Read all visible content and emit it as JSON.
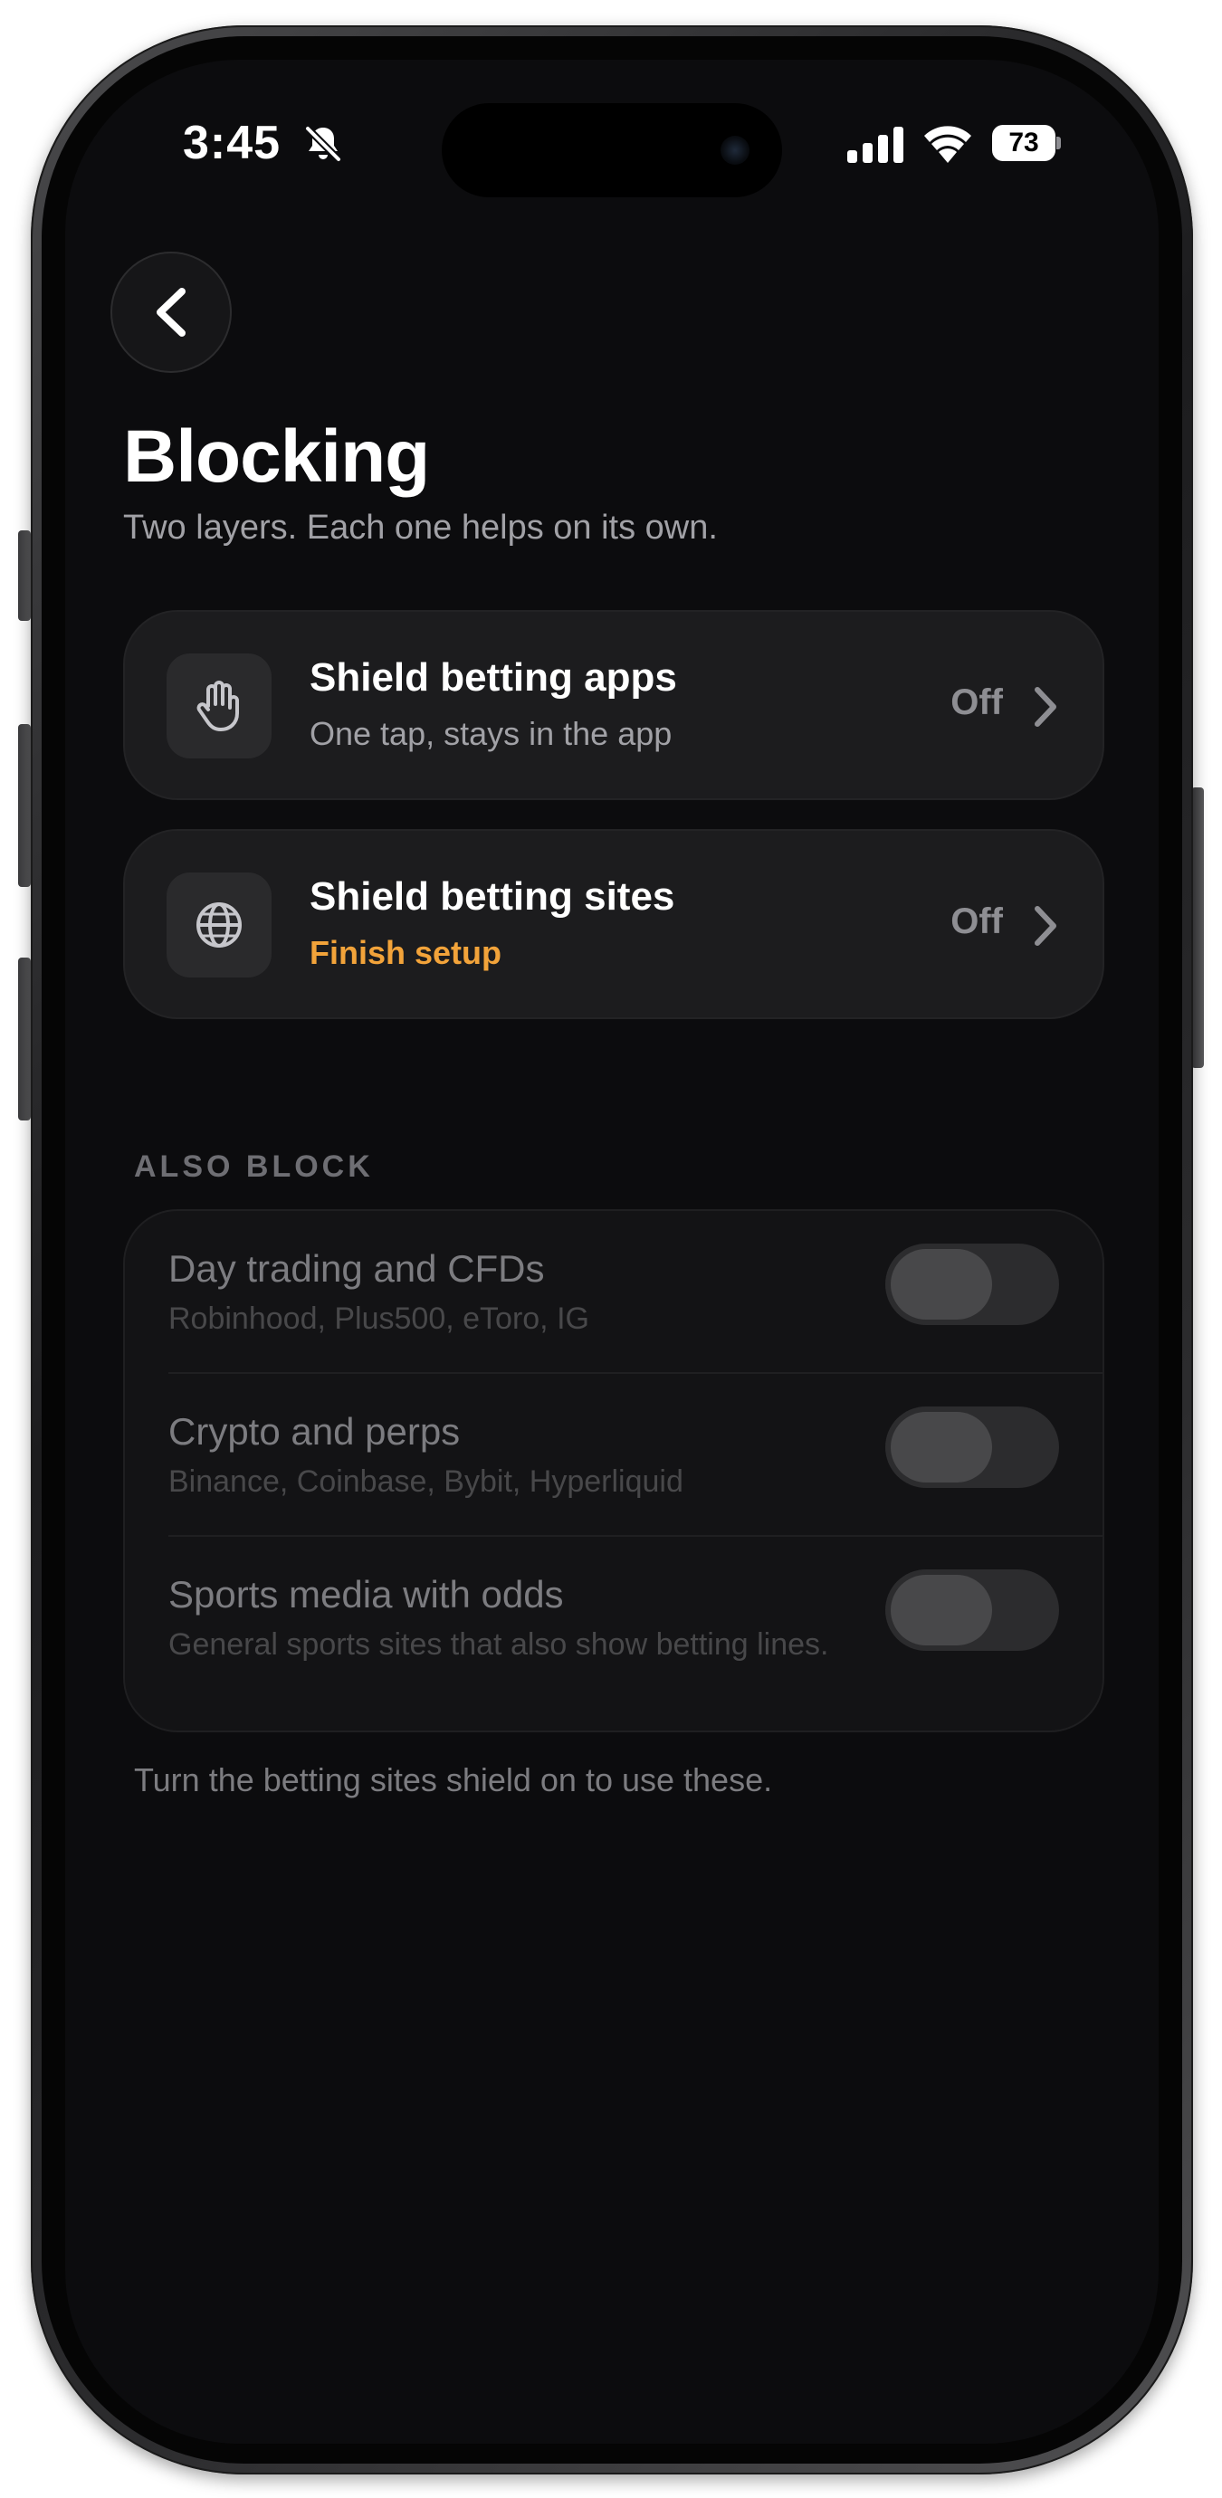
{
  "status_bar": {
    "time": "3:45",
    "battery": "73",
    "icons": [
      "bell-slash-icon",
      "cellular-signal-icon",
      "wifi-icon",
      "battery-icon"
    ]
  },
  "header": {
    "back_icon": "chevron-left-icon",
    "title": "Blocking",
    "subtitle": "Two layers. Each one helps on its own."
  },
  "shields": [
    {
      "icon": "hand-icon",
      "title": "Shield betting apps",
      "subtitle": "One tap, stays in the app",
      "status": "Off"
    },
    {
      "icon": "globe-icon",
      "title": "Shield betting sites",
      "subtitle": "Finish setup",
      "subtitle_color": "#f2a33a",
      "status": "Off"
    }
  ],
  "also_block": {
    "header": "ALSO BLOCK",
    "items": [
      {
        "title": "Day trading and CFDs",
        "subtitle": "Robinhood, Plus500, eToro, IG",
        "enabled": false
      },
      {
        "title": "Crypto and perps",
        "subtitle": "Binance, Coinbase, Bybit, Hyperliquid",
        "enabled": false
      },
      {
        "title": "Sports media with odds",
        "subtitle": "General sports sites that also show betting lines.",
        "enabled": false
      }
    ],
    "footnote": "Turn the betting sites shield on to use these."
  },
  "colors": {
    "background": "#0c0c0e",
    "card": "#1c1c1e",
    "accent_warning": "#f2a33a"
  }
}
